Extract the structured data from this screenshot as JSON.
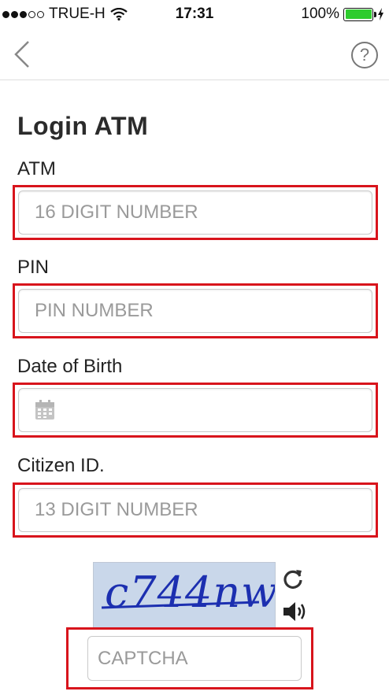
{
  "status_bar": {
    "carrier": "TRUE-H",
    "time": "17:31",
    "battery": "100%",
    "signal_strength": 3,
    "battery_level": 1.0
  },
  "nav": {
    "back_icon": "chevron-left-icon",
    "help_label": "?"
  },
  "page_title": "Login ATM",
  "fields": {
    "atm": {
      "label": "ATM",
      "placeholder": "16 DIGIT NUMBER",
      "value": ""
    },
    "pin": {
      "label": "PIN",
      "placeholder": "PIN NUMBER",
      "value": ""
    },
    "dob": {
      "label": "Date of Birth",
      "icon": "calendar-icon",
      "value": ""
    },
    "citizen": {
      "label": "Citizen ID.",
      "placeholder": "13 DIGIT NUMBER",
      "value": ""
    }
  },
  "captcha": {
    "image_text": "c744nw",
    "refresh_icon": "refresh-icon",
    "audio_icon": "speaker-icon",
    "placeholder": "CAPTCHA",
    "value": ""
  },
  "colors": {
    "highlight_border": "#d8141c",
    "battery": "#2ecc2e",
    "captcha_text": "#1c2fb0",
    "captcha_bg": "#c9d7ea"
  }
}
